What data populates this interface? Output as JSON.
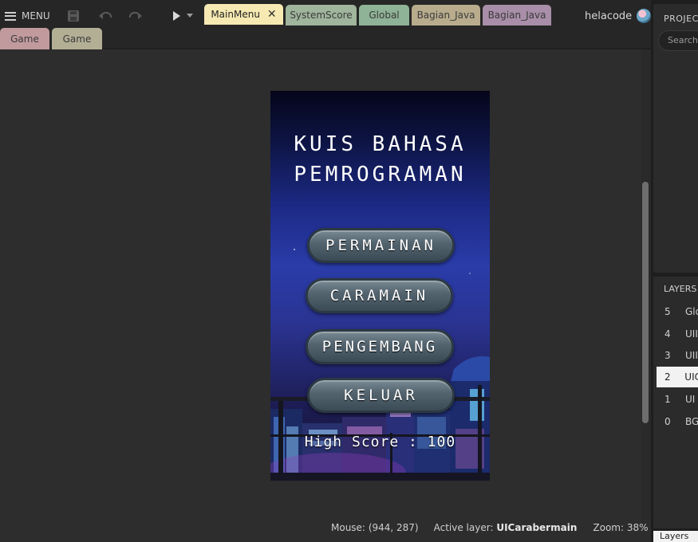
{
  "toolbar": {
    "menu_label": "MENU",
    "save_icon": "floppy-disk-icon",
    "undo_icon": "undo-icon",
    "redo_icon": "redo-icon",
    "play_icon": "play-icon",
    "play_dropdown_icon": "chevron-down-icon"
  },
  "tabs": [
    {
      "label": "MainMenu",
      "color": "#f6e9b2",
      "active": true,
      "close": "✕"
    },
    {
      "label": "SystemScore",
      "color": "#9fb59c"
    },
    {
      "label": "Global",
      "color": "#8fb396"
    },
    {
      "label": "Bagian_Java",
      "color": "#b8ac8d"
    },
    {
      "label": "Bagian_Java",
      "color": "#a88ea8"
    }
  ],
  "tabs_row2": [
    {
      "label": "Game",
      "color": "#c19a9e"
    },
    {
      "label": "Game",
      "color": "#b3af95"
    }
  ],
  "user": {
    "name": "helacode"
  },
  "game": {
    "title_line1": "KUIS BAHASA",
    "title_line2": "PEMROGRAMAN",
    "buttons": [
      "PERMAINAN",
      "CARAMAIN",
      "PENGEMBANG",
      "KELUAR"
    ],
    "score_text": "High Score : 100"
  },
  "status": {
    "mouse_label": "Mouse:",
    "mouse_value": "(944, 287)",
    "layer_label": "Active layer:",
    "layer_value": "UICarabermain",
    "zoom_label": "Zoom:",
    "zoom_value": "38%"
  },
  "project_panel": {
    "title": "PROJEC",
    "search_placeholder": "Search"
  },
  "layers_panel": {
    "title": "LAYERS",
    "rows": [
      {
        "num": "5",
        "name": "Glo"
      },
      {
        "num": "4",
        "name": "UII"
      },
      {
        "num": "3",
        "name": "UII"
      },
      {
        "num": "2",
        "name": "UIC",
        "selected": true
      },
      {
        "num": "1",
        "name": "UI"
      },
      {
        "num": "0",
        "name": "BG"
      }
    ],
    "bottom_tab": "Layers"
  }
}
